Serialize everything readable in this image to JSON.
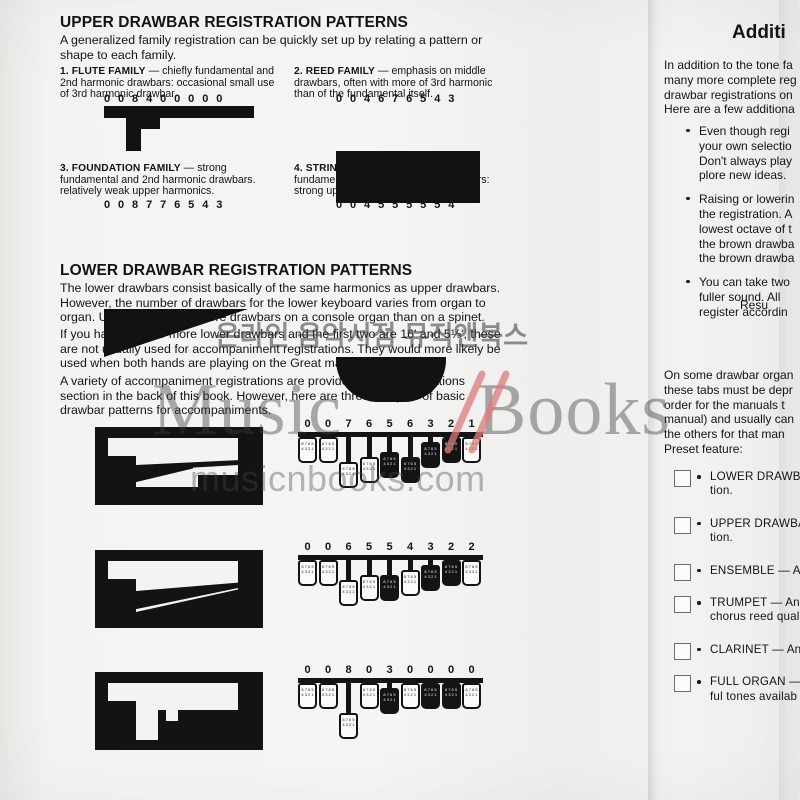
{
  "page": {
    "background": "#f4f3f1",
    "ink": "#141414"
  },
  "left": {
    "upper_heading": "UPPER DRAWBAR REGISTRATION PATTERNS",
    "upper_intro": "A generalized family registration can be quickly set up by relating a pattern or shape to each family.",
    "families": [
      {
        "index": "1.",
        "name": "FLUTE FAMILY",
        "dash": "—",
        "desc": "chiefly fundamental and 2nd harmonic drawbars: occasional small use of 3rd harmonic drawbar.",
        "registration": "0  0  8  4  0  0  0  0  0",
        "values": [
          0,
          0,
          8,
          4,
          0,
          0,
          0,
          0,
          0
        ],
        "shape": "flute"
      },
      {
        "index": "2.",
        "name": "REED FAMILY",
        "dash": "—",
        "desc": "emphasis on middle drawbars, often with more of 3rd harmonic than of the fundamental itself.",
        "registration": "0  0  4  6  7  6  5  4  3",
        "values": [
          0,
          0,
          4,
          6,
          7,
          6,
          5,
          4,
          3
        ],
        "shape": "reed"
      },
      {
        "index": "3.",
        "name": "FOUNDATION FAMILY",
        "dash": "—",
        "desc": "strong fundamental and 2nd harmonic drawbars. relatively weak upper harmonics.",
        "registration": "0  0  8  7  7  6  5  4  3",
        "values": [
          0,
          0,
          8,
          7,
          7,
          6,
          5,
          4,
          3
        ],
        "shape": "foundation"
      },
      {
        "index": "4.",
        "name": "STRING FAMILY",
        "dash": "—",
        "desc": "relatively weak fundamental and 2nd harmonic drawbars: strong upper harmonics.",
        "registration": "0  0  4  5  5  5  5  5  4",
        "values": [
          0,
          0,
          4,
          5,
          5,
          5,
          5,
          5,
          4
        ],
        "shape": "string"
      }
    ],
    "lower_heading": "LOWER DRAWBAR REGISTRATION PATTERNS",
    "lower_paragraphs": [
      "The lower drawbars consist basically of the same harmonics as upper drawbars. However, the number of drawbars for the lower keyboard varies from organ to organ. Usually, there are more drawbars on a console organ than on a spinet.",
      "If you have eight or more lower drawbars and the first two are 16' and 5⅓', these are not usually used for accompaniment registrations. They would more likely be used when both hands are playing on the Great manual.",
      "A variety of accompaniment registrations are provided in the Registrations section in the back of this book. However, here are three samples of basic drawbar patterns for accompaniments."
    ],
    "consoles": [
      {
        "registration": "0  0  7  6  5  6  3  2  1",
        "values": [
          0,
          0,
          7,
          6,
          5,
          6,
          3,
          2,
          1
        ]
      },
      {
        "registration": "0  0  6  5  5  4  3  2  2",
        "values": [
          0,
          0,
          6,
          5,
          5,
          4,
          3,
          2,
          2
        ]
      },
      {
        "registration": "0  0  8  0  3  0  0  0  0",
        "values": [
          0,
          0,
          8,
          0,
          3,
          0,
          0,
          0,
          0
        ]
      }
    ]
  },
  "right": {
    "heading": "Additi",
    "intro_lines": [
      "In addition to the tone fa",
      "many more complete reg",
      "drawbar registrations on",
      "Here are a few additiona"
    ],
    "bullets": [
      [
        "Even though regi",
        "your own selectio",
        "Don't always play",
        "plore new ideas."
      ],
      [
        "Raising or lowerin",
        "the registration. A",
        "lowest octave of t",
        "the brown drawba",
        "the brown drawba"
      ],
      [
        "You can take two",
        "fuller sound. All",
        "register accordin"
      ]
    ],
    "result_label": "Resu",
    "tabs_lines": [
      "On some drawbar organ",
      "these tabs must be depr",
      "order for the manuals t",
      "manual) and usually can",
      "the others for that man",
      "Preset feature:"
    ],
    "checkbox_items": [
      {
        "label": "LOWER DRAWBA",
        "dash": "",
        "line2": "tion."
      },
      {
        "label": "UPPER DRAWBAR",
        "dash": "",
        "line2": "tion."
      },
      {
        "label": "ENSEMBLE",
        "dash": "— A l",
        "line2": ""
      },
      {
        "label": "TRUMPET",
        "dash": "— An u",
        "line2": "chorus reed qual"
      },
      {
        "label": "CLARINET",
        "dash": "— An",
        "line2": ""
      },
      {
        "label": "FULL ORGAN",
        "dash": "— A",
        "line2": "ful tones availab"
      }
    ]
  },
  "watermark": {
    "brand_left": "Music",
    "brand_right": "Books",
    "url": "musicnbooks.com",
    "korean": "온라인 음악서점 뮤직앤북스",
    "slash_color": "#e07a7a",
    "text_color": "#3c3c3c"
  }
}
